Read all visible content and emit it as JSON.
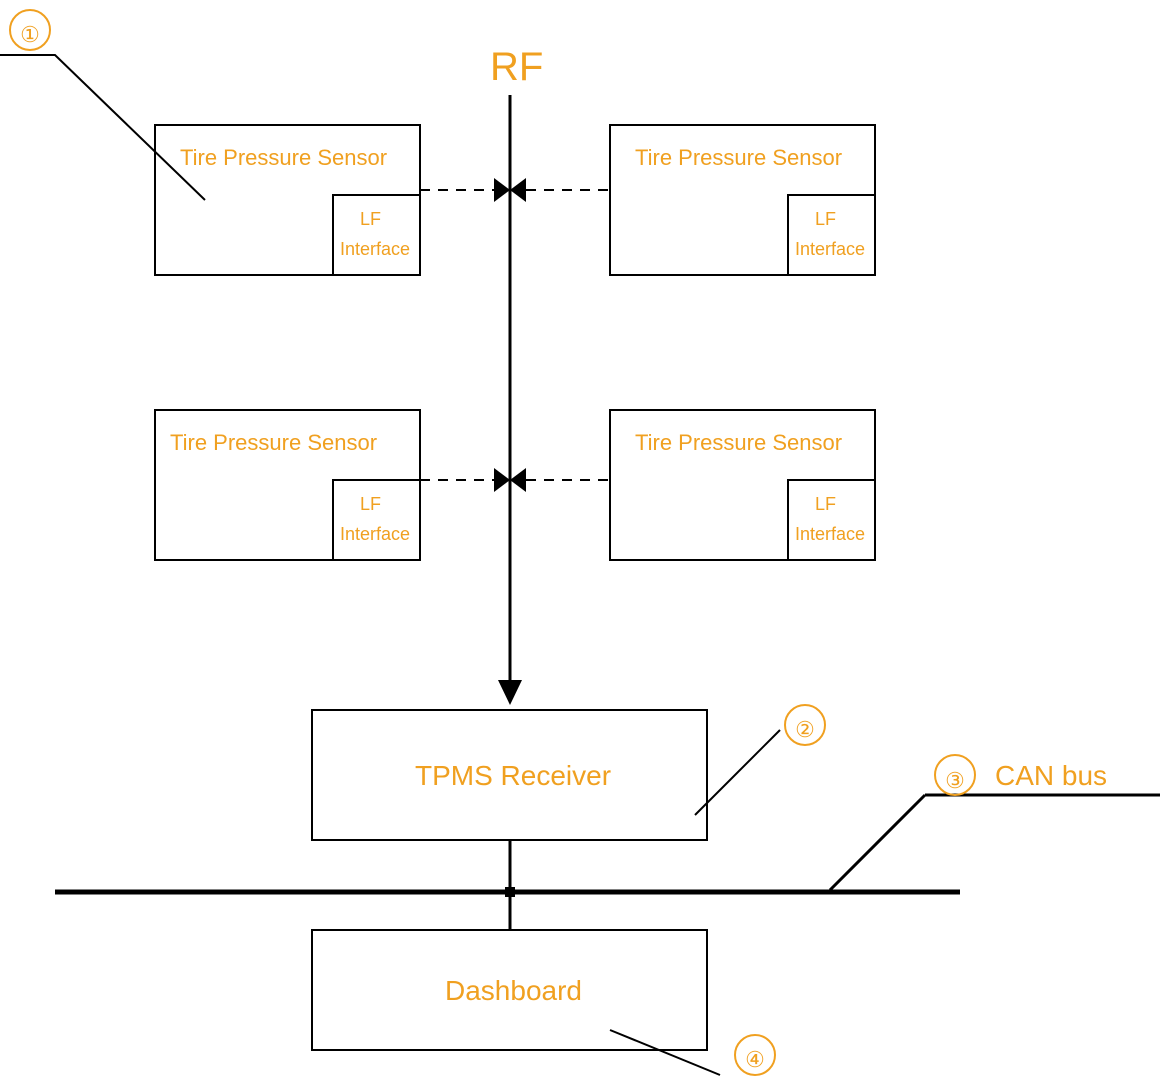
{
  "rf_label": "RF",
  "callouts": {
    "one": "①",
    "two": "②",
    "three": "③",
    "four": "④",
    "can_bus_label": "CAN bus"
  },
  "sensors": {
    "top_left": {
      "title": "Tire Pressure Sensor",
      "iface_line1": "LF",
      "iface_line2": "Interface"
    },
    "top_right": {
      "title": "Tire Pressure Sensor",
      "iface_line1": "LF",
      "iface_line2": "Interface"
    },
    "bottom_left": {
      "title": "Tire Pressure Sensor",
      "iface_line1": "LF",
      "iface_line2": "Interface"
    },
    "bottom_right": {
      "title": "Tire Pressure Sensor",
      "iface_line1": "LF",
      "iface_line2": "Interface"
    }
  },
  "receiver": {
    "label": "TPMS Receiver"
  },
  "dashboard": {
    "label": "Dashboard"
  }
}
